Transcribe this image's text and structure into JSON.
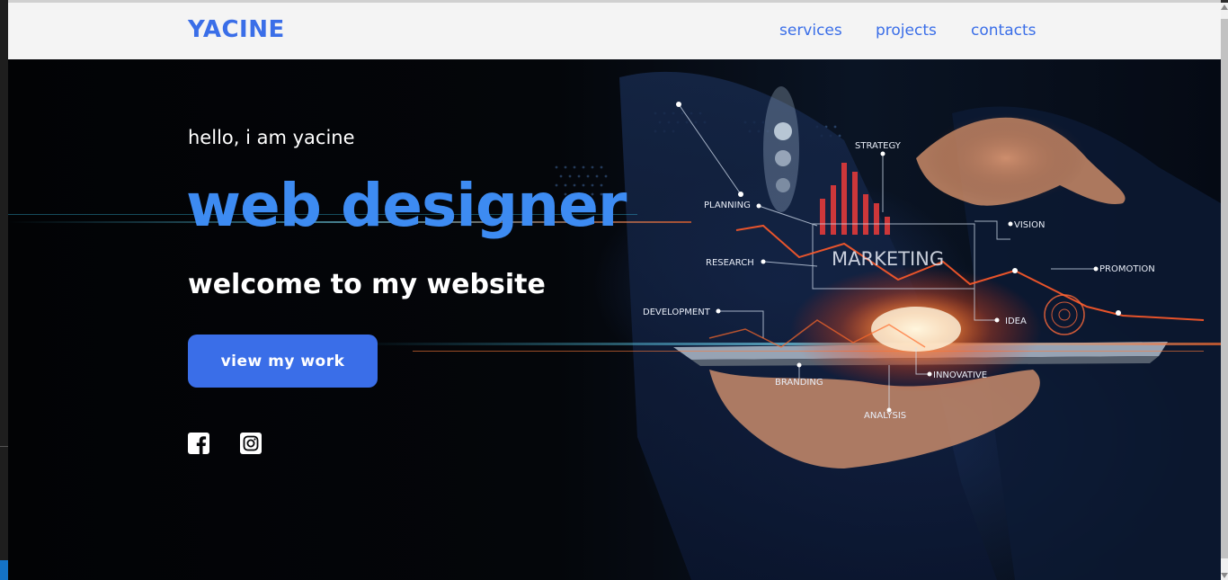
{
  "navbar": {
    "logo": "YACINE",
    "links": [
      {
        "label": "services"
      },
      {
        "label": "projects"
      },
      {
        "label": "contacts"
      }
    ]
  },
  "hero": {
    "greeting": "hello, i am yacine",
    "headline": "web designer",
    "subheadline": "welcome to my website",
    "cta_label": "view my work",
    "social": [
      {
        "icon": "facebook-icon"
      },
      {
        "icon": "instagram-icon"
      }
    ],
    "image_labels": {
      "strategy": "STRATEGY",
      "planning": "PLANNING",
      "research": "RESEARCH",
      "development": "DEVELOPMENT",
      "marketing": "MARKETING",
      "vision": "VISION",
      "promotion": "PROMOTION",
      "idea": "IDEA",
      "innovative": "INNOVATIVE",
      "branding": "BRANDING",
      "analysis": "ANALYSIS"
    }
  },
  "colors": {
    "accent": "#3a6ee8",
    "headline": "#3d8bf2",
    "navbar_bg": "#f4f4f4",
    "hero_bg": "#050608"
  }
}
